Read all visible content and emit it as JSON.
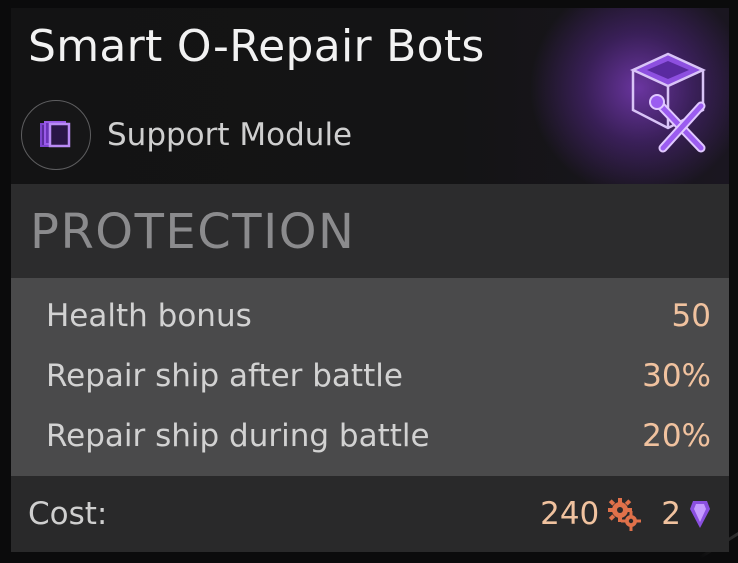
{
  "module": {
    "title": "Smart O-Repair Bots",
    "type_label": "Support Module",
    "icon": "repair-bot-module-icon",
    "glow_color": "#9a4ee6"
  },
  "section": {
    "title": "PROTECTION"
  },
  "stats": [
    {
      "label": "Health bonus",
      "value": "50"
    },
    {
      "label": "Repair ship after battle",
      "value": "30%"
    },
    {
      "label": "Repair ship during battle",
      "value": "20%"
    }
  ],
  "cost": {
    "label": "Cost:",
    "resource_amount": "240",
    "resource_icon": "gears-icon",
    "crystal_amount": "2",
    "crystal_icon": "crystal-icon"
  },
  "colors": {
    "value_text": "#f0c29f",
    "accent_purple": "#8a4fe0"
  }
}
